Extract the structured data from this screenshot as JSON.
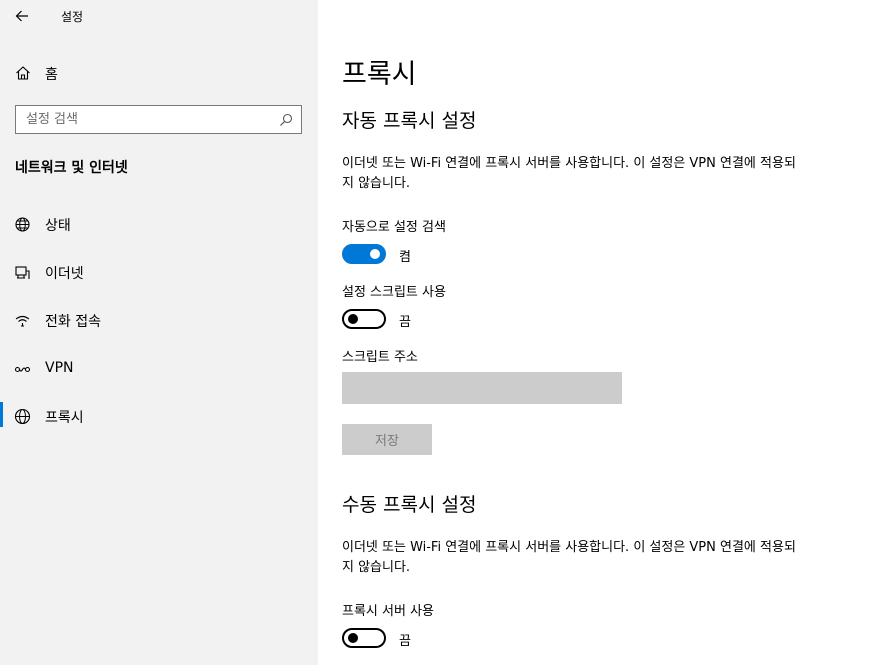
{
  "window": {
    "title": "설정"
  },
  "sidebar": {
    "home_label": "홈",
    "search_placeholder": "설정 검색",
    "section_title": "네트워크 및 인터넷",
    "items": [
      {
        "label": "상태",
        "icon": "globe-status-icon"
      },
      {
        "label": "이더넷",
        "icon": "ethernet-icon"
      },
      {
        "label": "전화 접속",
        "icon": "dialup-icon"
      },
      {
        "label": "VPN",
        "icon": "vpn-icon"
      },
      {
        "label": "프록시",
        "icon": "globe-icon",
        "selected": true
      }
    ]
  },
  "main": {
    "title": "프록시",
    "auto": {
      "title": "자동 프록시 설정",
      "description": "이더넷 또는 Wi-Fi 연결에 프록시 서버를 사용합니다. 이 설정은 VPN 연결에 적용되지 않습니다.",
      "detect_label": "자동으로 설정 검색",
      "detect_state": "켬",
      "script_label": "설정 스크립트 사용",
      "script_state": "끔",
      "address_label": "스크립트 주소",
      "address_value": "",
      "save_label": "저장"
    },
    "manual": {
      "title": "수동 프록시 설정",
      "description": "이더넷 또는 Wi-Fi 연결에 프록시 서버를 사용합니다. 이 설정은 VPN 연결에 적용되지 않습니다.",
      "proxy_label": "프록시 서버 사용",
      "proxy_state": "끔"
    }
  },
  "colors": {
    "accent": "#0078d7",
    "sidebar_bg": "#f2f2f2",
    "disabled": "#cccccc"
  }
}
